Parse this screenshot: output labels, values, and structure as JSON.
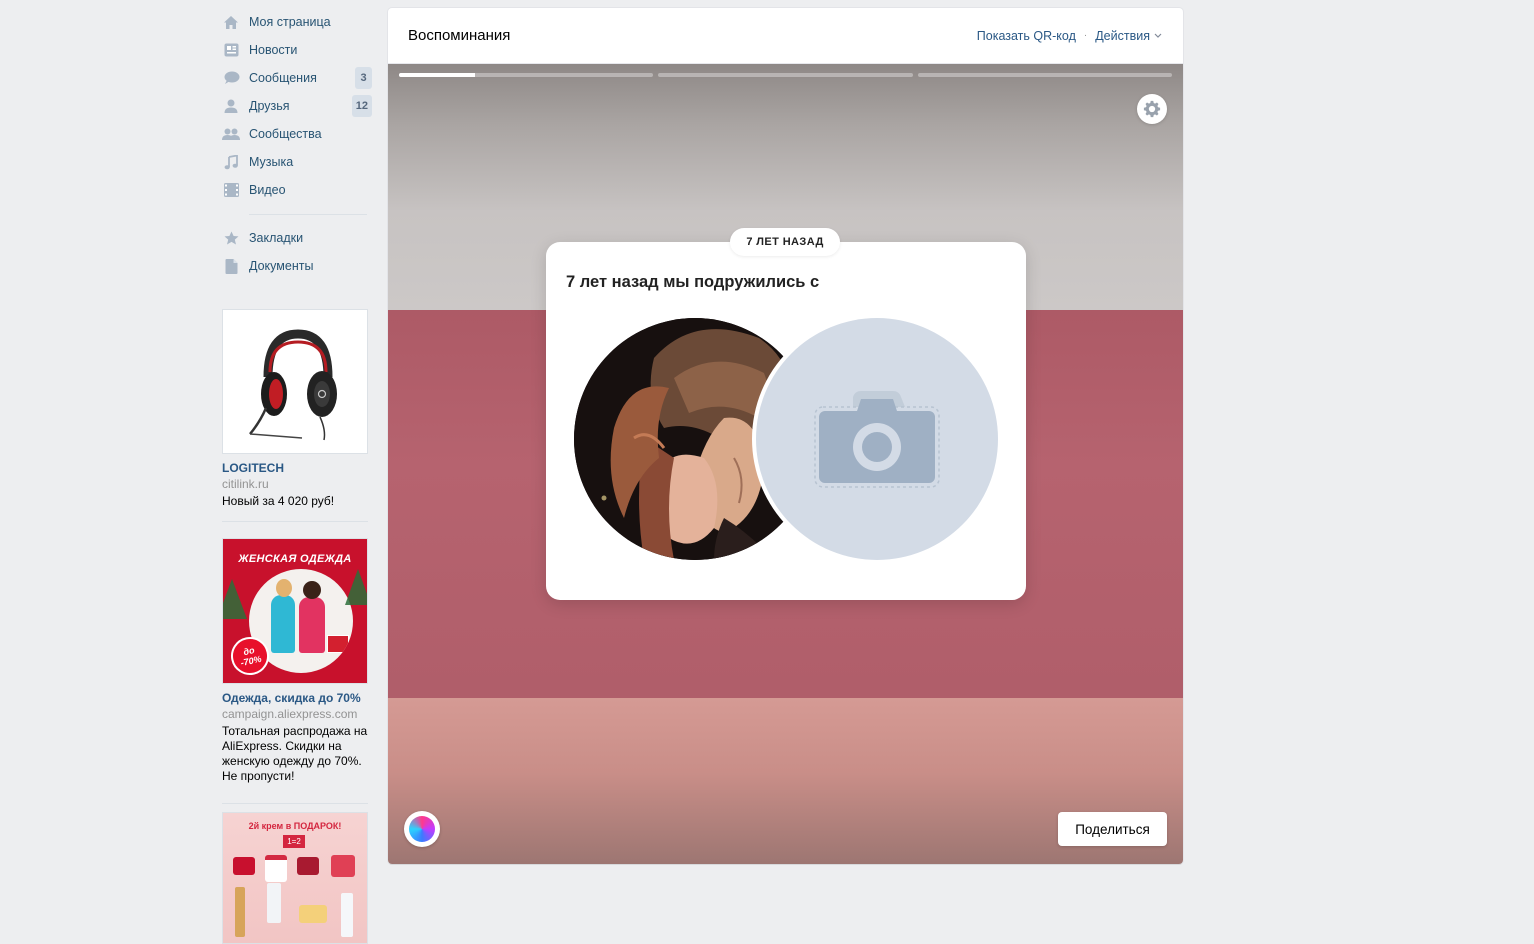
{
  "nav": {
    "items": [
      {
        "label": "Моя страница",
        "icon": "home-icon"
      },
      {
        "label": "Новости",
        "icon": "news-icon"
      },
      {
        "label": "Сообщения",
        "icon": "messages-icon",
        "badge": "3"
      },
      {
        "label": "Друзья",
        "icon": "friends-icon",
        "badge": "12"
      },
      {
        "label": "Сообщества",
        "icon": "groups-icon"
      },
      {
        "label": "Музыка",
        "icon": "music-icon"
      },
      {
        "label": "Видео",
        "icon": "video-icon"
      }
    ],
    "secondary": [
      {
        "label": "Закладки",
        "icon": "bookmark-star-icon"
      },
      {
        "label": "Документы",
        "icon": "document-icon"
      }
    ]
  },
  "ads": [
    {
      "title": "LOGITECH",
      "domain": "citilink.ru",
      "desc": "Новый за 4 020 руб!"
    },
    {
      "title": "Одежда, скидка до 70%",
      "domain": "campaign.aliexpress.com",
      "desc": "Тотальная распродажа на AliExpress. Скидки на женскую одежду до 70%. Не пропусти!",
      "banner_title": "ЖЕНСКАЯ ОДЕЖДА",
      "banner_badge_top": "до",
      "banner_badge_bottom": "-70%"
    },
    {
      "banner_title": "2й крем в ПОДАРОК!",
      "banner_badge": "1=2"
    }
  ],
  "page": {
    "title": "Воспоминания",
    "qr_link": "Показать QR-код",
    "actions_link": "Действия"
  },
  "story": {
    "progress": [
      0.3,
      0,
      0
    ],
    "pill": "7 ЛЕТ НАЗАД",
    "text": "7 лет назад мы подружились с",
    "share_label": "Поделиться"
  },
  "colors": {
    "link": "#2a5885",
    "nav_text": "#285473",
    "background": "#edeef0",
    "wall_top": "#c7c3c2",
    "wall_mid": "#b6636f",
    "wall_bottom": "#d59a94"
  }
}
